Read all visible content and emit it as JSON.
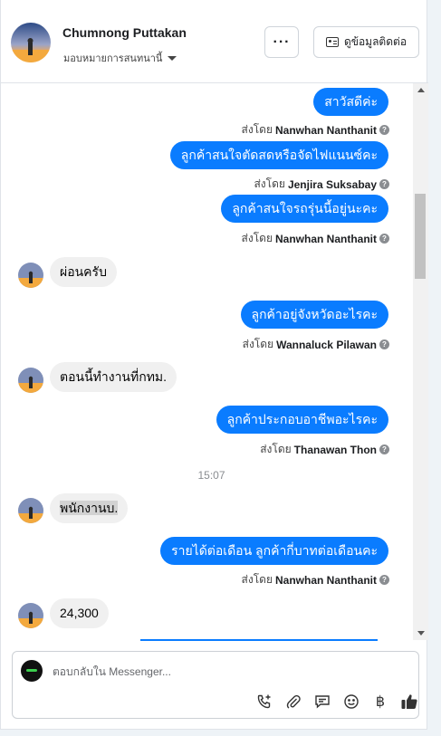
{
  "header": {
    "name": "Chumnong Puttakan",
    "assign_label": "มอบหมายการสนทนานี้",
    "more_label": "···",
    "contact_label": "ดูข้อมูลติดต่อ"
  },
  "thread": {
    "sent_by_prefix": "ส่งโดย",
    "time_divider": "15:07",
    "messages": [
      {
        "text": "สาวัสดีค่ะ",
        "sender": "Nanwhan Nanthanit"
      },
      {
        "text": "ลูกค้าสนใจตัดสดหรือจัดไฟแนนซ์คะ",
        "sender": "Jenjira Suksabay"
      },
      {
        "text": "ลูกค้าสนใจรถรุ่นนี้อยู่นะคะ",
        "sender": "Nanwhan Nanthanit"
      },
      {
        "text": "ผ่อนครับ"
      },
      {
        "text": "ลูกค้าอยู่จังหวัดอะไรคะ",
        "sender": "Wannaluck Pilawan"
      },
      {
        "text": "ตอนนี้ทำงานที่กทม."
      },
      {
        "text": "ลูกค้าประกอบอาชีพอะไรคะ",
        "sender": "Thanawan Thon"
      },
      {
        "text": "พนักงานบ."
      },
      {
        "text": "รายได้ต่อเดือน ลูกค้ากี่บาทต่อเดือนคะ",
        "sender": "Nanwhan Nanthanit"
      },
      {
        "text": "24,300"
      }
    ]
  },
  "composer": {
    "placeholder": "ตอบกลับใน Messenger..."
  },
  "icons": {
    "tools": [
      "phone-plus-icon",
      "paperclip-icon",
      "chat-bubble-icon",
      "emoji-icon",
      "baht-icon",
      "thumbs-up-icon"
    ],
    "baht_glyph": "฿"
  },
  "colors": {
    "accent": "#0a7cff",
    "incoming_bubble": "#f0f0f0"
  }
}
